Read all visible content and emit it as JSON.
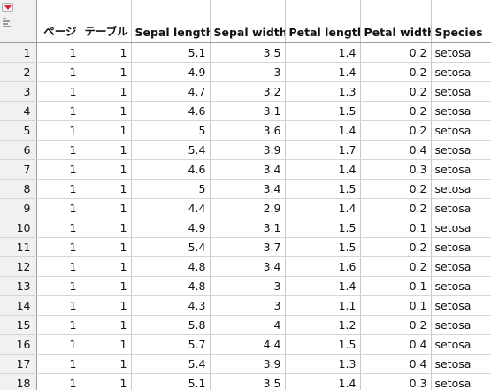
{
  "icons": {
    "table_menu": "red-triangle-menu-icon",
    "column_switcher": "column-list-icon"
  },
  "colors": {
    "menu_triangle": "#d8262b",
    "header_border": "#9d9d9d",
    "rownum_bg": "#f1f1f1"
  },
  "columns": [
    "ページ",
    "テーブル",
    "Sepal length",
    "Sepal width",
    "Petal length",
    "Petal width",
    "Species"
  ],
  "rows": [
    {
      "n": "1",
      "cells": [
        "1",
        "1",
        "5.1",
        "3.5",
        "1.4",
        "0.2",
        "setosa"
      ]
    },
    {
      "n": "2",
      "cells": [
        "1",
        "1",
        "4.9",
        "3",
        "1.4",
        "0.2",
        "setosa"
      ]
    },
    {
      "n": "3",
      "cells": [
        "1",
        "1",
        "4.7",
        "3.2",
        "1.3",
        "0.2",
        "setosa"
      ]
    },
    {
      "n": "4",
      "cells": [
        "1",
        "1",
        "4.6",
        "3.1",
        "1.5",
        "0.2",
        "setosa"
      ]
    },
    {
      "n": "5",
      "cells": [
        "1",
        "1",
        "5",
        "3.6",
        "1.4",
        "0.2",
        "setosa"
      ]
    },
    {
      "n": "6",
      "cells": [
        "1",
        "1",
        "5.4",
        "3.9",
        "1.7",
        "0.4",
        "setosa"
      ]
    },
    {
      "n": "7",
      "cells": [
        "1",
        "1",
        "4.6",
        "3.4",
        "1.4",
        "0.3",
        "setosa"
      ]
    },
    {
      "n": "8",
      "cells": [
        "1",
        "1",
        "5",
        "3.4",
        "1.5",
        "0.2",
        "setosa"
      ]
    },
    {
      "n": "9",
      "cells": [
        "1",
        "1",
        "4.4",
        "2.9",
        "1.4",
        "0.2",
        "setosa"
      ]
    },
    {
      "n": "10",
      "cells": [
        "1",
        "1",
        "4.9",
        "3.1",
        "1.5",
        "0.1",
        "setosa"
      ]
    },
    {
      "n": "11",
      "cells": [
        "1",
        "1",
        "5.4",
        "3.7",
        "1.5",
        "0.2",
        "setosa"
      ]
    },
    {
      "n": "12",
      "cells": [
        "1",
        "1",
        "4.8",
        "3.4",
        "1.6",
        "0.2",
        "setosa"
      ]
    },
    {
      "n": "13",
      "cells": [
        "1",
        "1",
        "4.8",
        "3",
        "1.4",
        "0.1",
        "setosa"
      ]
    },
    {
      "n": "14",
      "cells": [
        "1",
        "1",
        "4.3",
        "3",
        "1.1",
        "0.1",
        "setosa"
      ]
    },
    {
      "n": "15",
      "cells": [
        "1",
        "1",
        "5.8",
        "4",
        "1.2",
        "0.2",
        "setosa"
      ]
    },
    {
      "n": "16",
      "cells": [
        "1",
        "1",
        "5.7",
        "4.4",
        "1.5",
        "0.4",
        "setosa"
      ]
    },
    {
      "n": "17",
      "cells": [
        "1",
        "1",
        "5.4",
        "3.9",
        "1.3",
        "0.4",
        "setosa"
      ]
    },
    {
      "n": "18",
      "cells": [
        "1",
        "1",
        "5.1",
        "3.5",
        "1.4",
        "0.3",
        "setosa"
      ]
    }
  ]
}
